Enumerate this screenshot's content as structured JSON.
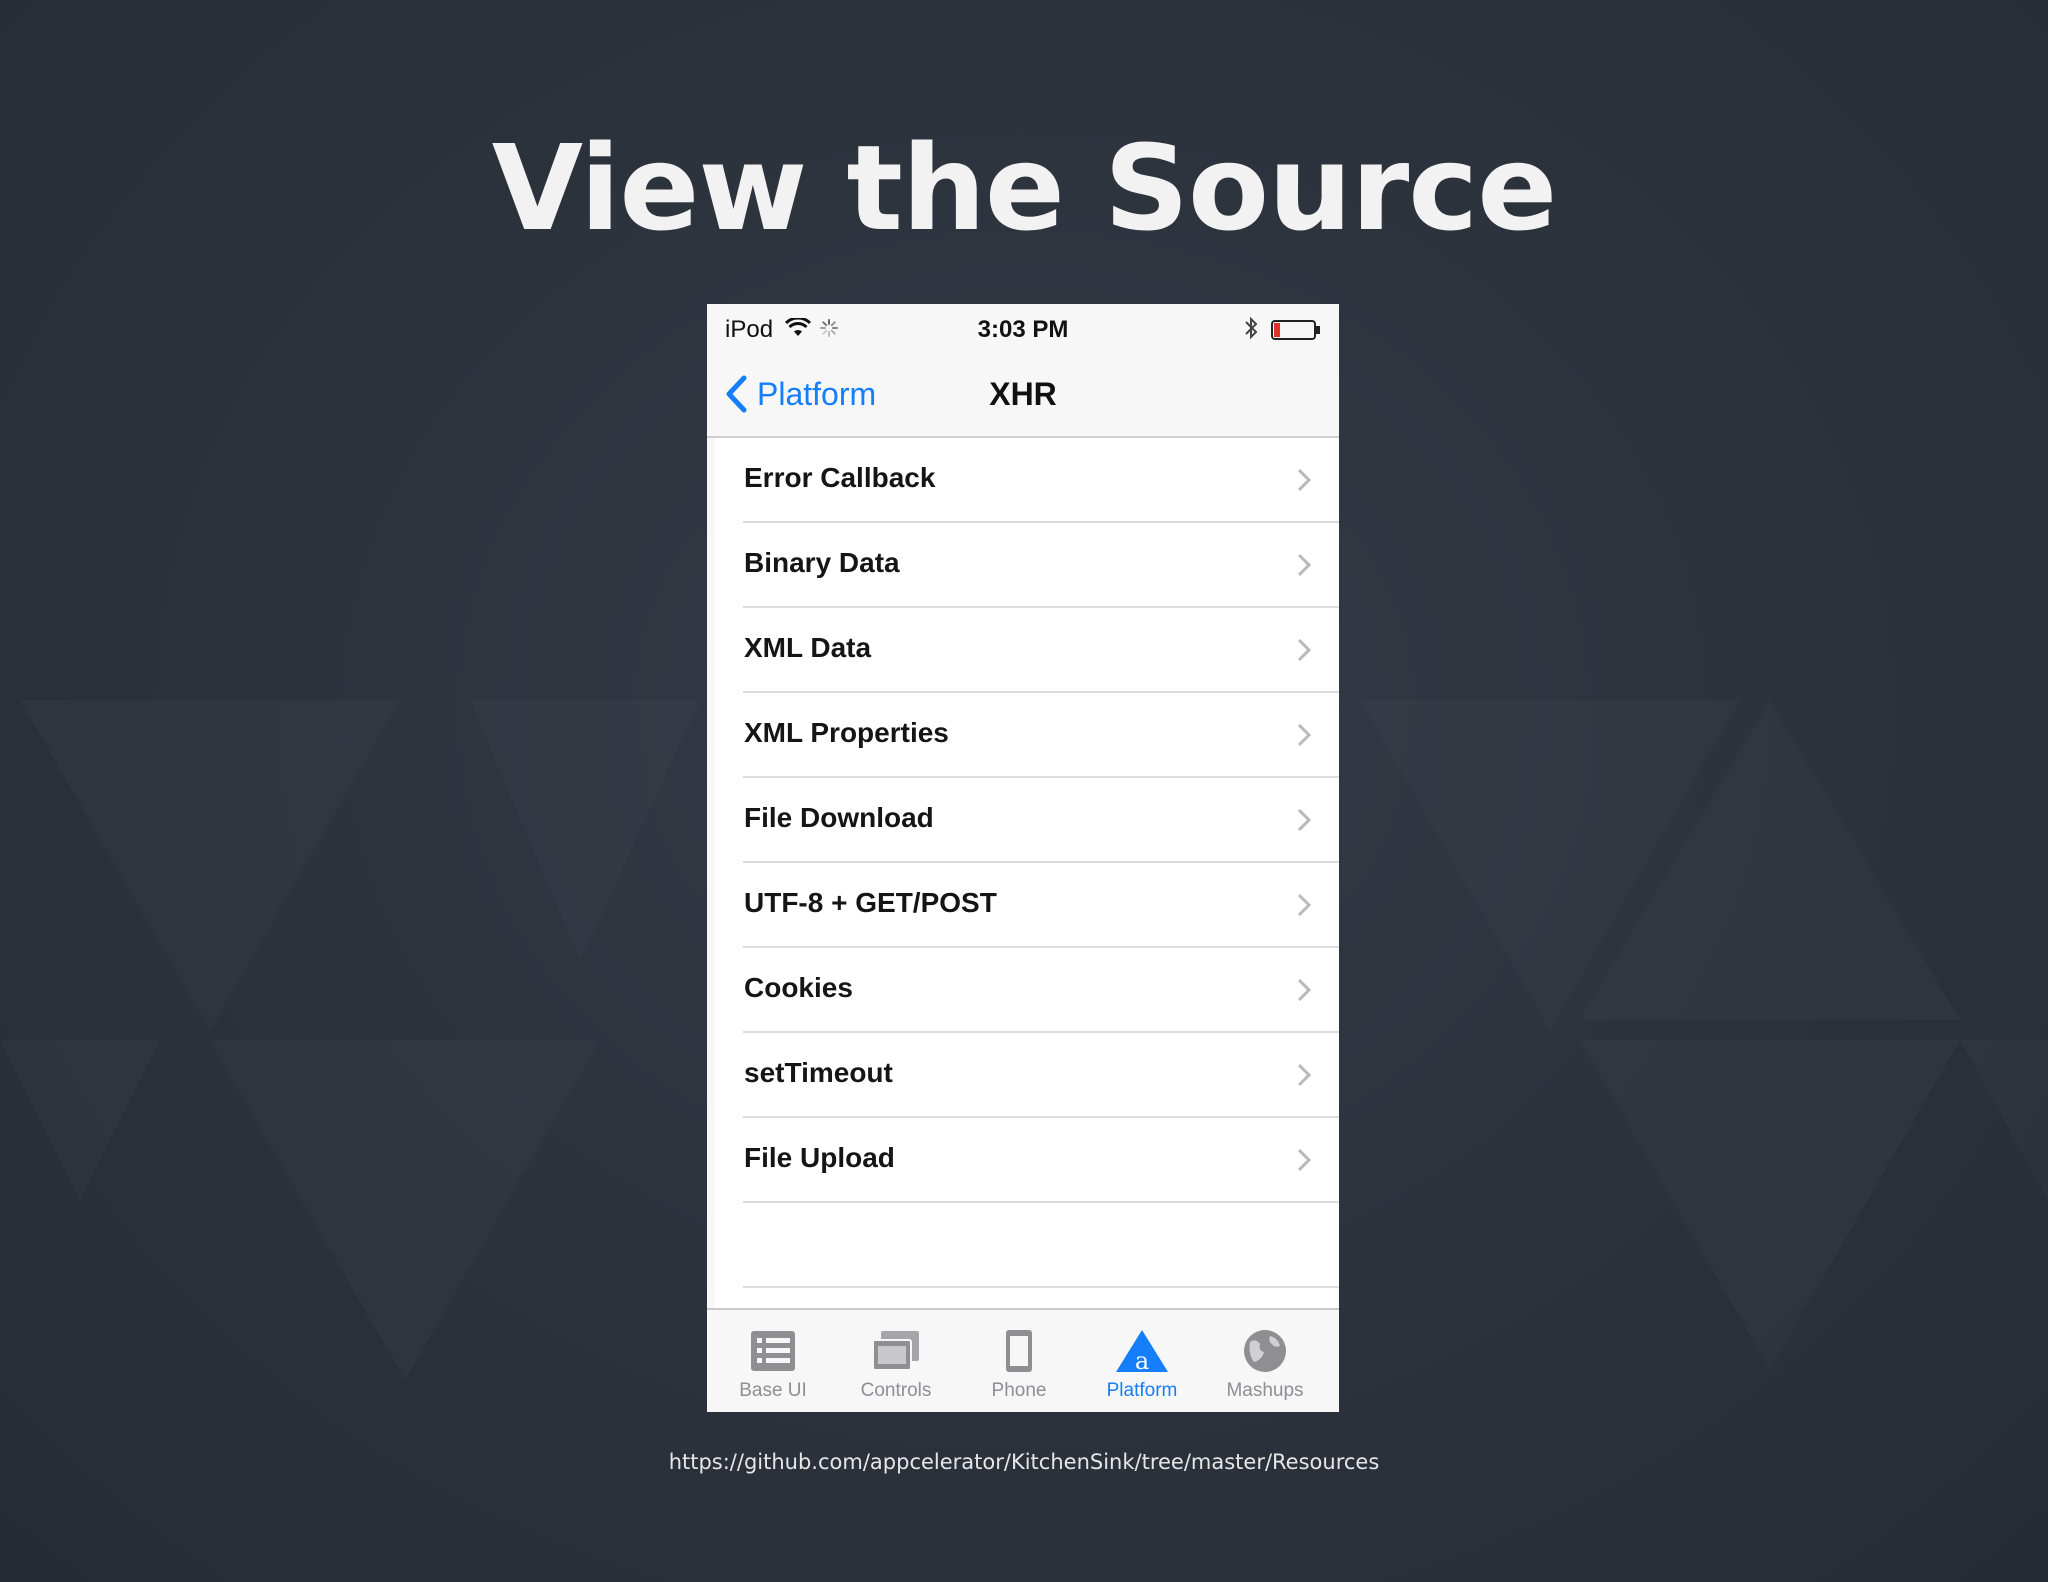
{
  "slide": {
    "title": "View the Source",
    "link": "https://github.com/appcelerator/KitchenSink/tree/master/Resources"
  },
  "colors": {
    "slide_background": "#2b313b",
    "title_text": "#f2f2f2",
    "ios_blue": "#147efb",
    "tab_inactive": "#8e8e93",
    "battery_low": "#e0302b"
  },
  "status_bar": {
    "carrier": "iPod",
    "time": "3:03 PM",
    "icons": [
      "wifi-icon",
      "activity-spinner-icon",
      "bluetooth-icon",
      "battery-icon"
    ],
    "battery_level": 0.15
  },
  "nav": {
    "back_label": "Platform",
    "title": "XHR"
  },
  "list": {
    "items": [
      {
        "label": "Error Callback"
      },
      {
        "label": "Binary Data"
      },
      {
        "label": "XML Data"
      },
      {
        "label": "XML Properties"
      },
      {
        "label": "File Download"
      },
      {
        "label": "UTF-8 + GET/POST"
      },
      {
        "label": "Cookies"
      },
      {
        "label": "setTimeout"
      },
      {
        "label": "File Upload"
      }
    ]
  },
  "tabs": [
    {
      "label": "Base UI",
      "icon": "list-icon",
      "active": false
    },
    {
      "label": "Controls",
      "icon": "controls-icon",
      "active": false
    },
    {
      "label": "Phone",
      "icon": "phone-icon",
      "active": false
    },
    {
      "label": "Platform",
      "icon": "platform-logo-icon",
      "active": true
    },
    {
      "label": "Mashups",
      "icon": "globe-icon",
      "active": false
    }
  ]
}
